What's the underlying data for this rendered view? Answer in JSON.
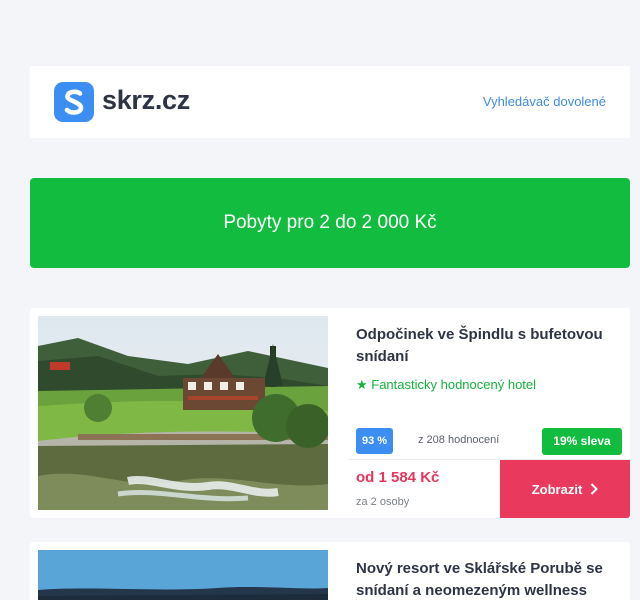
{
  "header": {
    "logo_text": "skrz.cz",
    "link_label": "Vyhledávač dovolené"
  },
  "promo": {
    "label": "Pobyty pro 2 do 2 000 Kč"
  },
  "offers": [
    {
      "title": "Odpočinek ve Špindlu s bufetovou snídaní",
      "rating_label": "★ Fantasticky hodnocený hotel",
      "score": "93 %",
      "reviews": "z 208 hodnocení",
      "discount": "19% sleva",
      "price": "od 1 584 Kč",
      "persons": "za 2 osoby",
      "button_label": "Zobrazit"
    },
    {
      "title": "Nový resort ve Sklářské Porubě se snídaní a neomezeným wellness"
    }
  ],
  "colors": {
    "brand_blue": "#3d8ef2",
    "promo_green": "#12bc3f",
    "price_red": "#e8355e",
    "button_red": "#e93a5e"
  },
  "icons": {
    "logo": "skrz-s-logo-icon",
    "rating": "star-icon",
    "button": "chevron-right-icon"
  }
}
